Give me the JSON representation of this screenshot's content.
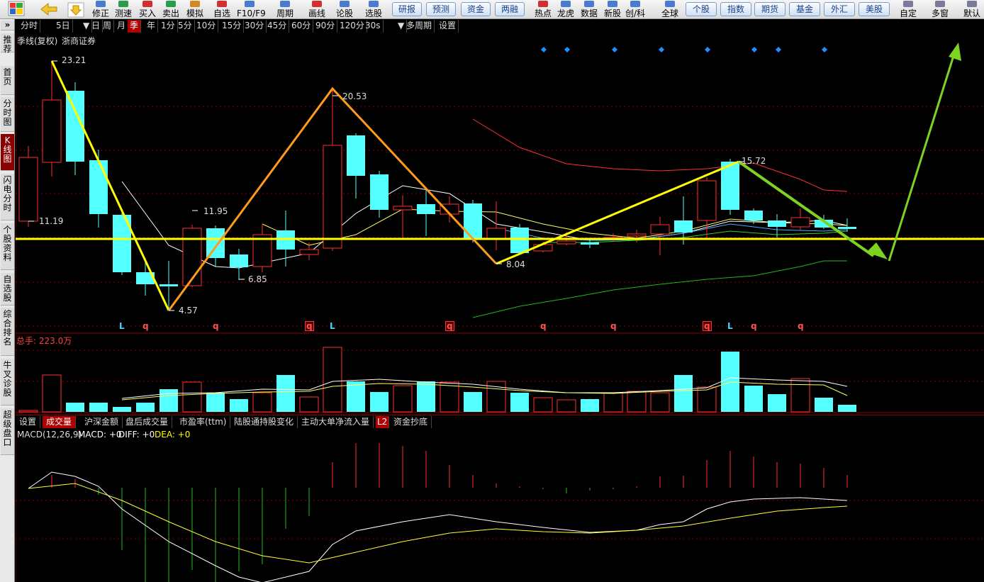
{
  "toolbar": {
    "buttons": [
      {
        "label": "修正",
        "icon": "edit-icon"
      },
      {
        "label": "测速",
        "icon": "speed-icon"
      },
      {
        "label": "买入",
        "icon": "buy-icon"
      },
      {
        "label": "卖出",
        "icon": "sell-icon"
      },
      {
        "label": "模拟",
        "icon": "simulate-icon"
      },
      {
        "label": "自选",
        "icon": "favorites-icon"
      },
      {
        "label": "F10/F9",
        "icon": "f10-icon"
      },
      {
        "label": "周期",
        "icon": "period-icon"
      },
      {
        "label": "画线",
        "icon": "draw-line-icon"
      },
      {
        "label": "论股",
        "icon": "forum-icon"
      },
      {
        "label": "选股",
        "icon": "stock-picker-icon"
      }
    ],
    "pills_a": [
      "研报",
      "预测",
      "资金",
      "两融"
    ],
    "buttons_b": [
      {
        "label": "热点",
        "icon": "hot-icon"
      },
      {
        "label": "龙虎",
        "icon": "dragon-tiger-icon"
      },
      {
        "label": "数据",
        "icon": "data-icon"
      },
      {
        "label": "新股",
        "icon": "ipo-icon"
      },
      {
        "label": "创/科",
        "icon": "star-market-icon"
      },
      {
        "label": "全球",
        "icon": "globe-icon"
      }
    ],
    "pills_b": [
      "个股",
      "指数",
      "期货",
      "基金",
      "外汇",
      "美股"
    ],
    "buttons_c": [
      {
        "label": "自定",
        "icon": "custom-icon"
      },
      {
        "label": "多窗",
        "icon": "multi-window-icon"
      },
      {
        "label": "默认",
        "icon": "default-icon"
      }
    ]
  },
  "sidebar": {
    "collapse": "»",
    "items": [
      "推荐",
      "首页",
      "分时图",
      "K线图",
      "闪电分时",
      "个股资料",
      "自选股",
      "综合排名",
      "牛叉诊股",
      "超级盘口"
    ],
    "active": "K线图"
  },
  "periodbar": {
    "items": [
      "分时",
      "5日",
      "▼",
      "日",
      "周",
      "月",
      "季",
      "年",
      "1分",
      "5分",
      "10分",
      "15分",
      "30分",
      "45分",
      "60分",
      "90分",
      "120分",
      "30s",
      "▼",
      "多周期",
      "设置"
    ],
    "active": "季"
  },
  "main_chart": {
    "title": "季线(复权)",
    "broker": "浙商证券",
    "price_labels": {
      "high1": "23.21",
      "left": "11.19",
      "low1": "4.57",
      "mid1": "11.95",
      "low2": "6.85",
      "high2": "20.53",
      "low3": "8.04",
      "high3": "15.72"
    },
    "signals": [
      "L",
      "q",
      "q",
      "q",
      "L",
      "q",
      "q",
      "q",
      "q",
      "L",
      "q",
      "q"
    ]
  },
  "volume_panel": {
    "label": "总手: 223.0万"
  },
  "indicator_tabs": {
    "items": [
      "设置",
      "成交量",
      "沪深金额",
      "盘后成交量",
      "市盈率(ttm)",
      "陆股通持股变化",
      "主动大单净流入量",
      "L2",
      "资金抄底"
    ],
    "active": "成交量"
  },
  "macd": {
    "name": "MACD(12,26,9)",
    "macd_label": "MACD: +0",
    "diff_label": "DIFF: +0",
    "dea_label": "DEA: +0"
  },
  "colors": {
    "up": "#ff3030",
    "down": "#54ffff",
    "yellow": "#ffff00",
    "orange": "#ff9b1a",
    "green": "#7ed321",
    "toolbar_bg": "#e6e6e6",
    "active_red": "#b00000"
  }
}
